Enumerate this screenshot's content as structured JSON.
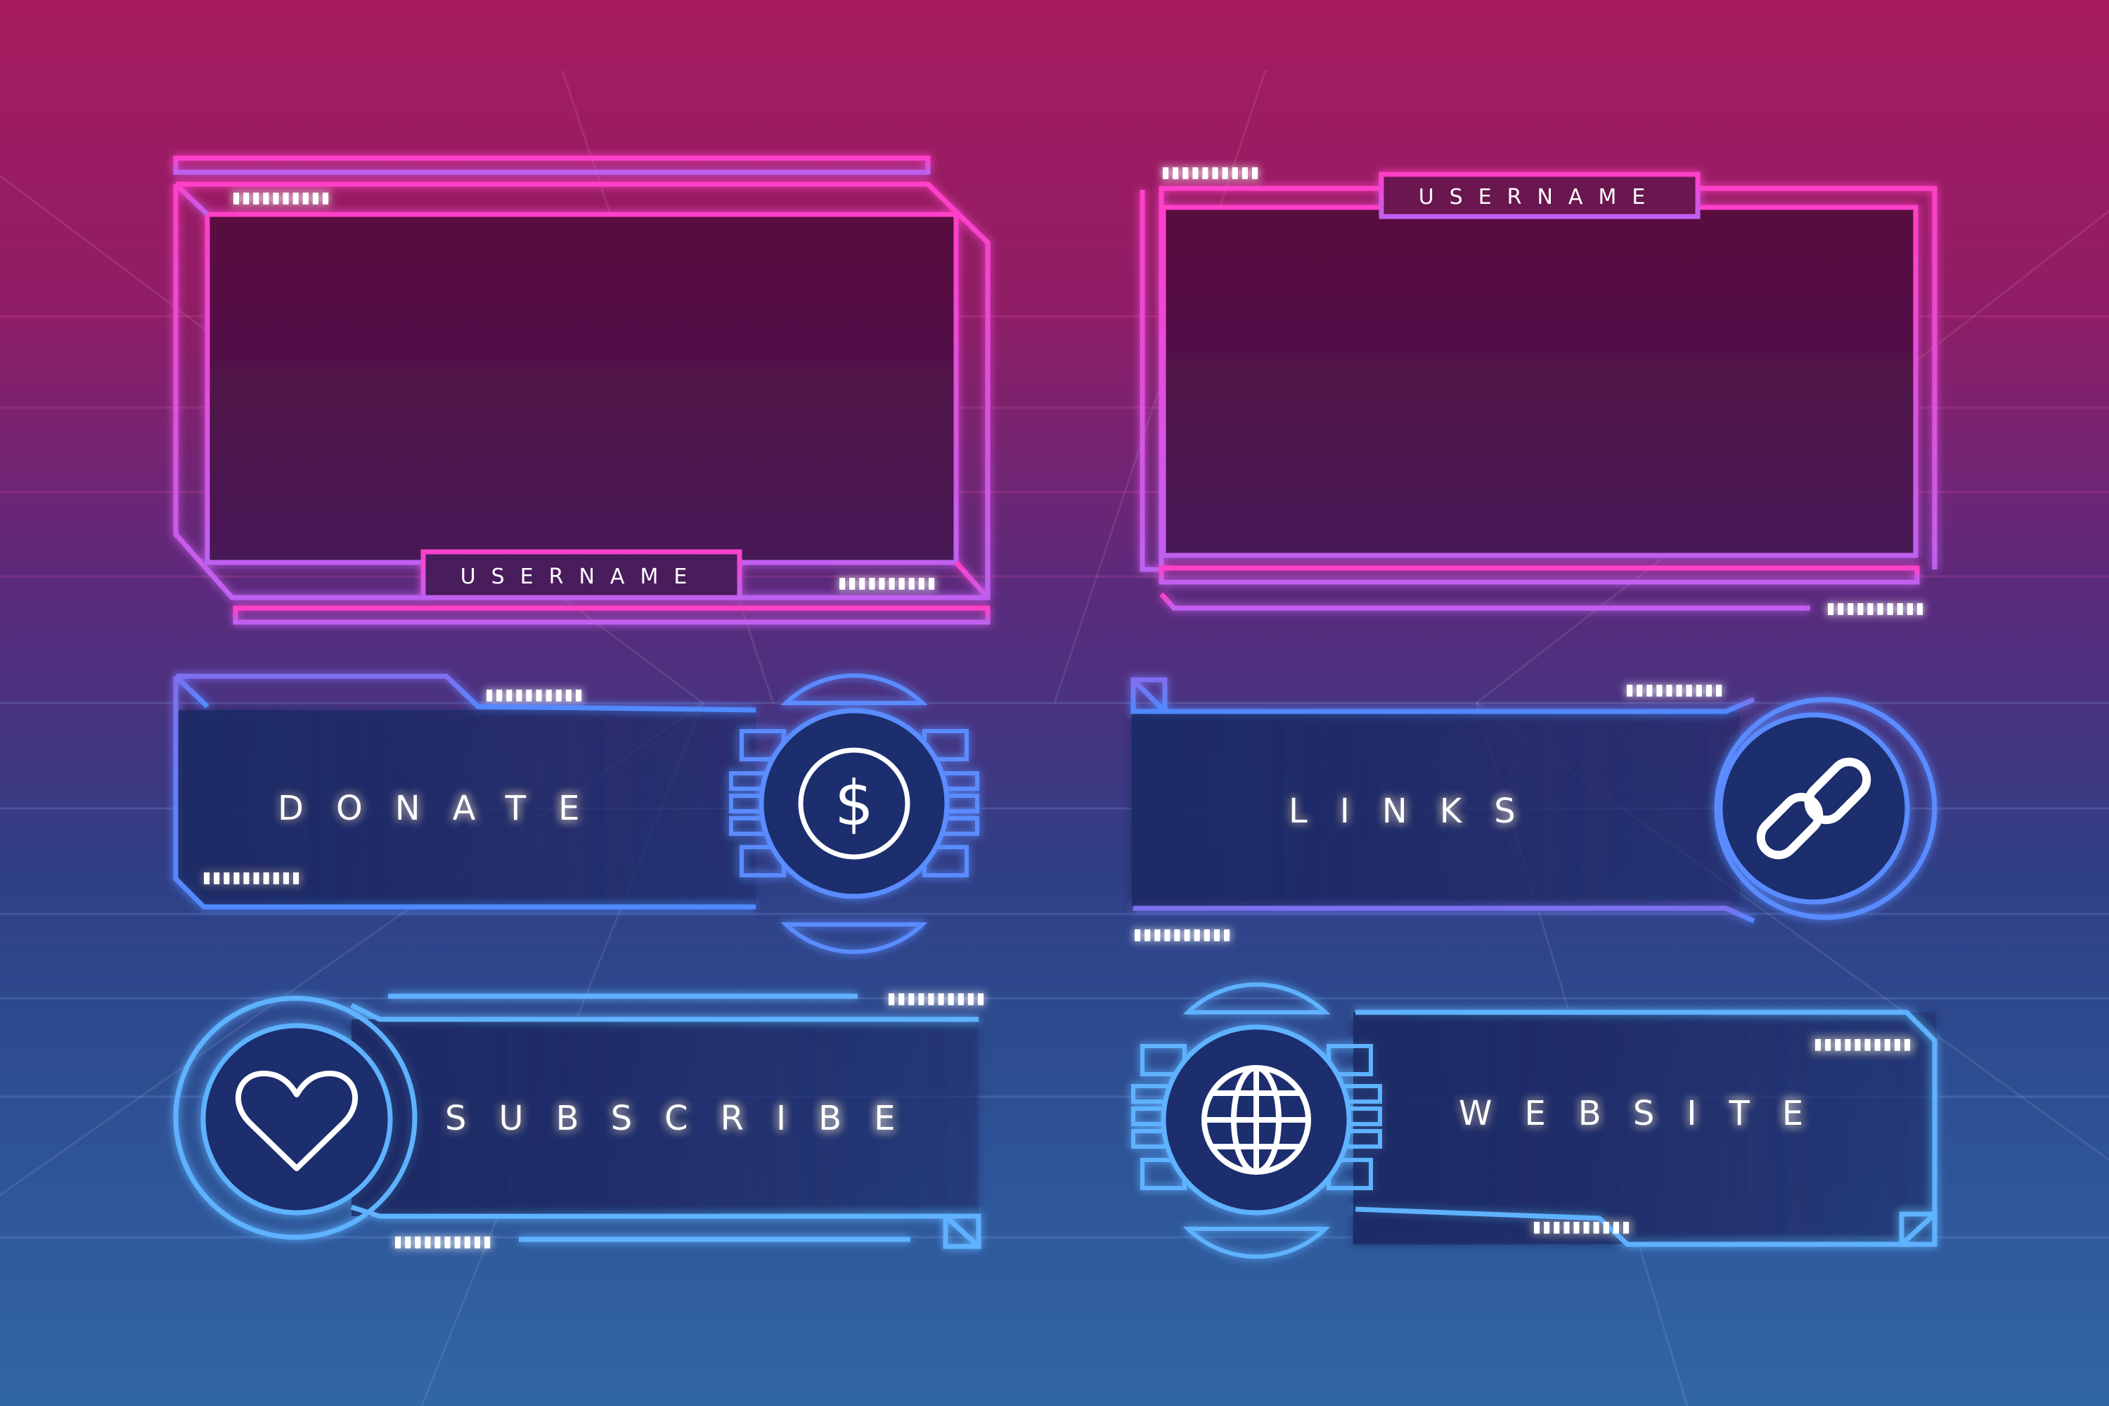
{
  "colors": {
    "neon_pink": "#ff3fc8",
    "neon_purple": "#b26cf0",
    "neon_blue": "#5a8cff",
    "neon_cyan": "#5fb2ff",
    "text": "#ffffff"
  },
  "camera_frame_left": {
    "username": "USERNAME"
  },
  "camera_frame_right": {
    "username": "USERNAME"
  },
  "panels": {
    "donate": {
      "label": "DONATE",
      "icon": "dollar-coin-icon"
    },
    "links": {
      "label": "LINKS",
      "icon": "chain-link-icon"
    },
    "subscribe": {
      "label": "SUBSCRIBE",
      "icon": "heart-icon"
    },
    "website": {
      "label": "WEBSITE",
      "icon": "globe-icon"
    }
  }
}
